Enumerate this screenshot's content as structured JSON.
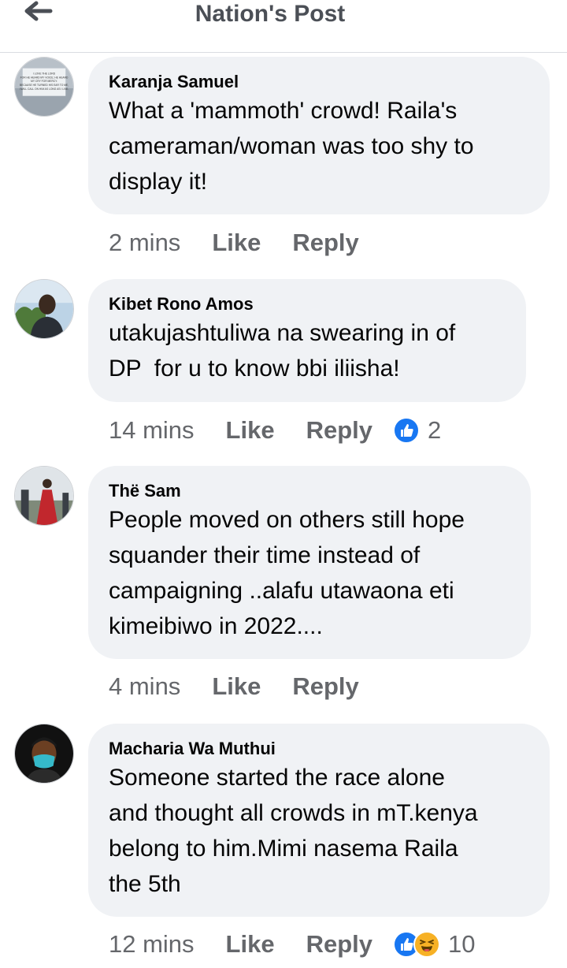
{
  "header": {
    "title": "Nation's Post",
    "back_icon": "arrow-left-icon"
  },
  "colors": {
    "bubble": "#f0f2f5",
    "meta": "#65676b",
    "like_blue": "#1877f2",
    "haha_yellow": "#f7b125"
  },
  "comments": [
    {
      "author": "Karanja Samuel",
      "text": "What a 'mammoth' crowd! Raila's\ncameraman/woman was too shy to\ndisplay it!",
      "time": "2 mins",
      "like": "Like",
      "reply": "Reply",
      "avatar_caption": [
        "I LOVE THE LORD",
        "FOR HE HEARD MY VOICE; HE HEARD",
        "MY CRY FOR MERCY.",
        "BECAUSE HE TURNED HIS EAR TO ME,",
        "I WILL CALL ON HIM AS LONG AS I LIVE."
      ]
    },
    {
      "author": "Kibet Rono Amos",
      "text": "utakujashtuliwa na swearing in of\nDP  for u to know bbi iliisha!",
      "time": "14 mins",
      "like": "Like",
      "reply": "Reply",
      "reactions": [
        "like"
      ],
      "reaction_count": "2"
    },
    {
      "author": "Thë Sam",
      "text": "People moved on others still hope\nsquander their time instead of\ncampaigning ..alafu utawaona eti\nkimeibiwo in 2022....",
      "time": "4 mins",
      "like": "Like",
      "reply": "Reply"
    },
    {
      "author": "Macharia Wa Muthui",
      "text": "Someone started the race alone\nand thought all crowds in mT.kenya\nbelong to him.Mimi nasema Raila\nthe 5th",
      "time": "12 mins",
      "like": "Like",
      "reply": "Reply",
      "reactions": [
        "like",
        "haha"
      ],
      "reaction_count": "10"
    }
  ]
}
